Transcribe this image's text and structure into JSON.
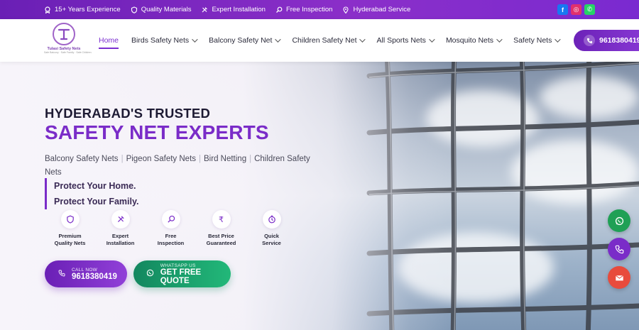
{
  "topbar": {
    "items": [
      {
        "icon": "badge-icon",
        "text": "15+ Years Experience"
      },
      {
        "icon": "shield-icon",
        "text": "Quality Materials"
      },
      {
        "icon": "tools-icon",
        "text": "Expert Installation"
      },
      {
        "icon": "search-icon",
        "text": "Free Inspection"
      },
      {
        "icon": "location-pin-icon",
        "text": "Hyderabad Service"
      }
    ],
    "social": {
      "facebook": "f",
      "instagram": "◎",
      "whatsapp": "✆"
    }
  },
  "logo": {
    "name": "Tulasi Safety Nets",
    "tagline": "Safe Balcony · Safe Family · Safe Children"
  },
  "nav": {
    "items": [
      {
        "label": "Home",
        "active": true,
        "dropdown": false
      },
      {
        "label": "Birds Safety Nets",
        "dropdown": true
      },
      {
        "label": "Balcony Safety Net",
        "dropdown": true
      },
      {
        "label": "Children Safety Net",
        "dropdown": true
      },
      {
        "label": "All Sports Nets",
        "dropdown": true
      },
      {
        "label": "Mosquito Nets",
        "dropdown": true
      },
      {
        "label": "Safety Nets",
        "dropdown": true
      }
    ],
    "cta_phone": "9618380419"
  },
  "hero": {
    "headline_1": "HYDERABAD'S TRUSTED",
    "headline_2": "SAFETY NET EXPERTS",
    "services": [
      "Balcony Safety Nets",
      "Pigeon Safety Nets",
      "Bird Netting",
      "Children Safety Nets"
    ],
    "protect_1": "Protect Your Home.",
    "protect_2": "Protect Your Family.",
    "features": [
      {
        "icon": "shield-icon",
        "line1": "Premium",
        "line2": "Quality Nets"
      },
      {
        "icon": "tools-icon",
        "line1": "Expert",
        "line2": "Installation"
      },
      {
        "icon": "search-icon",
        "line1": "Free",
        "line2": "Inspection"
      },
      {
        "icon": "rupee-icon",
        "line1": "Best Price",
        "line2": "Guaranteed"
      },
      {
        "icon": "clock-icon",
        "line1": "Quick",
        "line2": "Service"
      }
    ],
    "call_btn": {
      "small": "CALL NOW",
      "big": "9618380419"
    },
    "whatsapp_btn": {
      "small": "WHATSAPP US",
      "big": "GET FREE QUOTE"
    }
  },
  "colors": {
    "brand_purple": "#7a2cc8",
    "whatsapp_green": "#1fa055",
    "mail_red": "#e84b3c"
  }
}
